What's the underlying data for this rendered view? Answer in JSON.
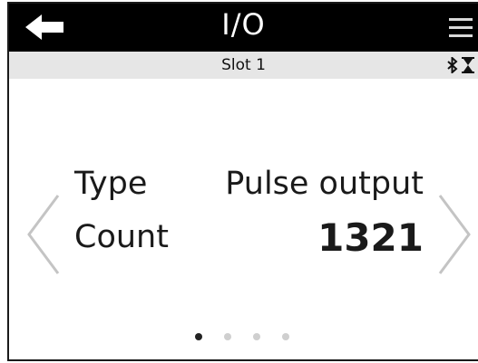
{
  "header": {
    "title": "I/O",
    "back_icon": "arrow-left-icon",
    "menu_icon": "hamburger-menu-icon"
  },
  "subheader": {
    "title": "Slot 1",
    "status_icons": [
      "bluetooth-icon",
      "hourglass-icon"
    ]
  },
  "fields": [
    {
      "label": "Type",
      "value": "Pulse output"
    },
    {
      "label": "Count",
      "value": "1321"
    }
  ],
  "pagination": {
    "total": 4,
    "active": 1
  },
  "colors": {
    "titlebar_bg": "#000000",
    "subbar_bg": "#e6e6e6",
    "text": "#1a1a1a",
    "chevron": "#c4c4c4",
    "dot_active": "#222222",
    "dot_inactive": "#cfcfcf"
  }
}
